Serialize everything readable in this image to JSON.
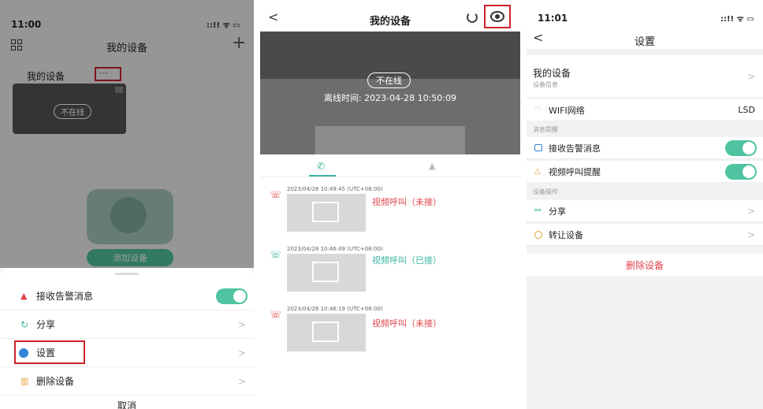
{
  "colors": {
    "accent": "#4fc3a1",
    "red": "#e0454a",
    "teal": "#3bb5a0",
    "highlight": "#d0202c"
  },
  "panel1": {
    "status_time": "11:00",
    "status_icons": "::!! ᯤ ▭",
    "header": {
      "title": "我的设备",
      "add_icon": "+"
    },
    "device": {
      "name": "我的设备",
      "more": "···",
      "offline": "不在线"
    },
    "add_device_label": "添加设备",
    "sheet": {
      "items": [
        {
          "label": "接收告警消息",
          "icon": "bell-icon",
          "toggle": true
        },
        {
          "label": "分享",
          "icon": "share-icon",
          "chevron": ">"
        },
        {
          "label": "设置",
          "icon": "settings-icon",
          "chevron": ">"
        },
        {
          "label": "删除设备",
          "icon": "trash-icon",
          "chevron": ">"
        }
      ],
      "cancel": "取消"
    }
  },
  "panel2": {
    "header": {
      "back": "<",
      "title": "我的设备"
    },
    "offline": "不在线",
    "offline_time": "离线时间: 2023-04-28 10:50:09",
    "logs": [
      {
        "time": "2023/04/28 10:49:45",
        "tz": "(UTC+08:00)",
        "text": "视频呼叫（未接）",
        "answered": false
      },
      {
        "time": "2023/04/28 10:46:49",
        "tz": "(UTC+08:00)",
        "text": "视频呼叫（已接）",
        "answered": true
      },
      {
        "time": "2023/04/28 10:46:19",
        "tz": "(UTC+08:00)",
        "text": "视频呼叫（未接）",
        "answered": false
      }
    ]
  },
  "panel3": {
    "status_time": "11:01",
    "status_icons": "::!! ᯤ ▭",
    "header": {
      "back": "<",
      "title": "设置"
    },
    "my_device": {
      "title": "我的设备",
      "subtitle": "设备信息",
      "chevron": ">"
    },
    "wifi": {
      "label": "WIFI网络",
      "value": "LSD"
    },
    "section_msg": "消息提醒",
    "alarm_label": "接收告警消息",
    "call_label": "视频呼叫提醒",
    "section_ops": "设备操作",
    "share_label": "分享",
    "transfer_label": "转让设备",
    "chevron": ">",
    "delete_label": "删除设备"
  }
}
